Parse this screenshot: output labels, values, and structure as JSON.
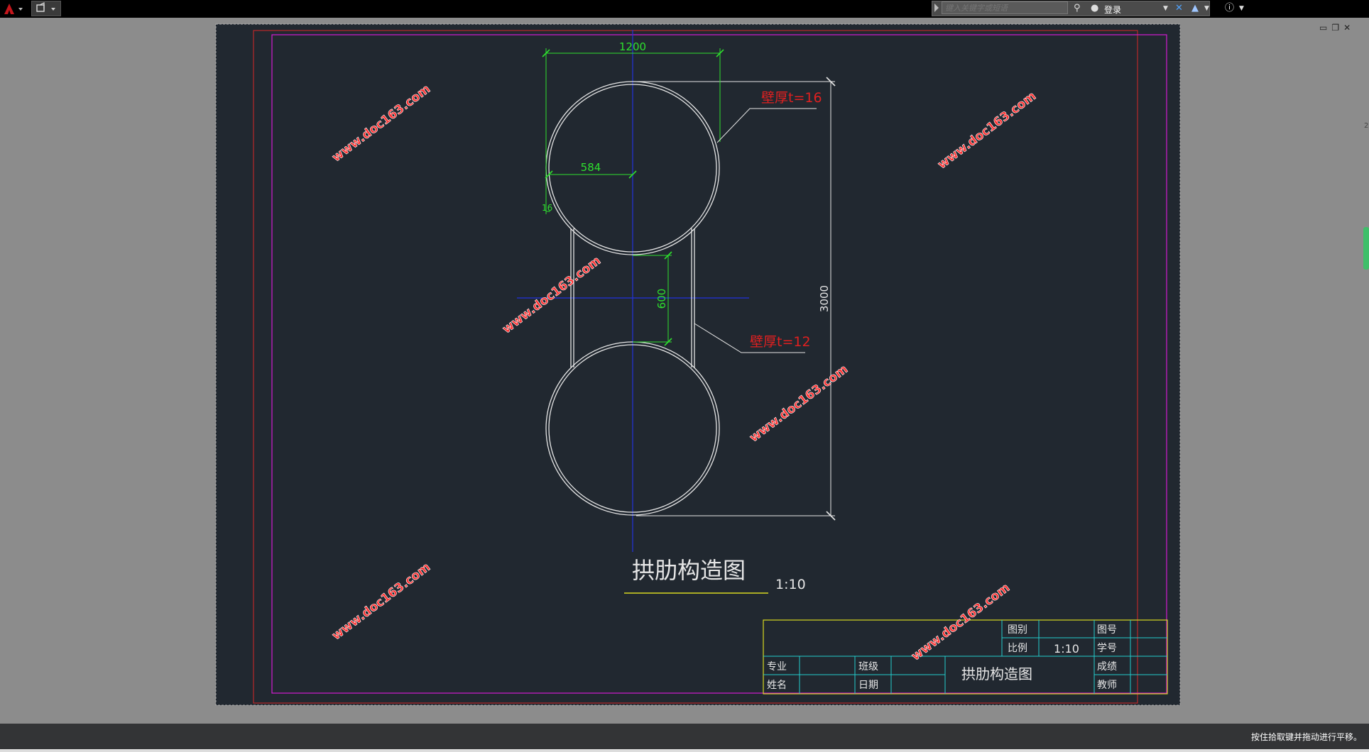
{
  "toolbar": {
    "search_placeholder": "键入关键字或短语",
    "login_label": "登录"
  },
  "status": {
    "message": "按住拾取键并拖动进行平移。"
  },
  "drawing": {
    "dims": {
      "width": "1200",
      "radius": "584",
      "thickness": "16",
      "gap": "600",
      "height": "3000"
    },
    "labels": {
      "wall_top": "壁厚t=16",
      "wall_mid": "壁厚t=12"
    },
    "title": "拱肋构造图",
    "scale": "1:10",
    "watermark": "www.doc163.com",
    "title_block": {
      "tubie_label": "图别",
      "tuhao_label": "图号",
      "bili_label": "比例",
      "bili_value": "1:10",
      "xuehao_label": "学号",
      "zhuanye_label": "专业",
      "banji_label": "班级",
      "chengji_label": "成绩",
      "xingming_label": "姓名",
      "riqi_label": "日期",
      "jiaoshi_label": "教师",
      "drawing_name": "拱肋构造图"
    }
  }
}
